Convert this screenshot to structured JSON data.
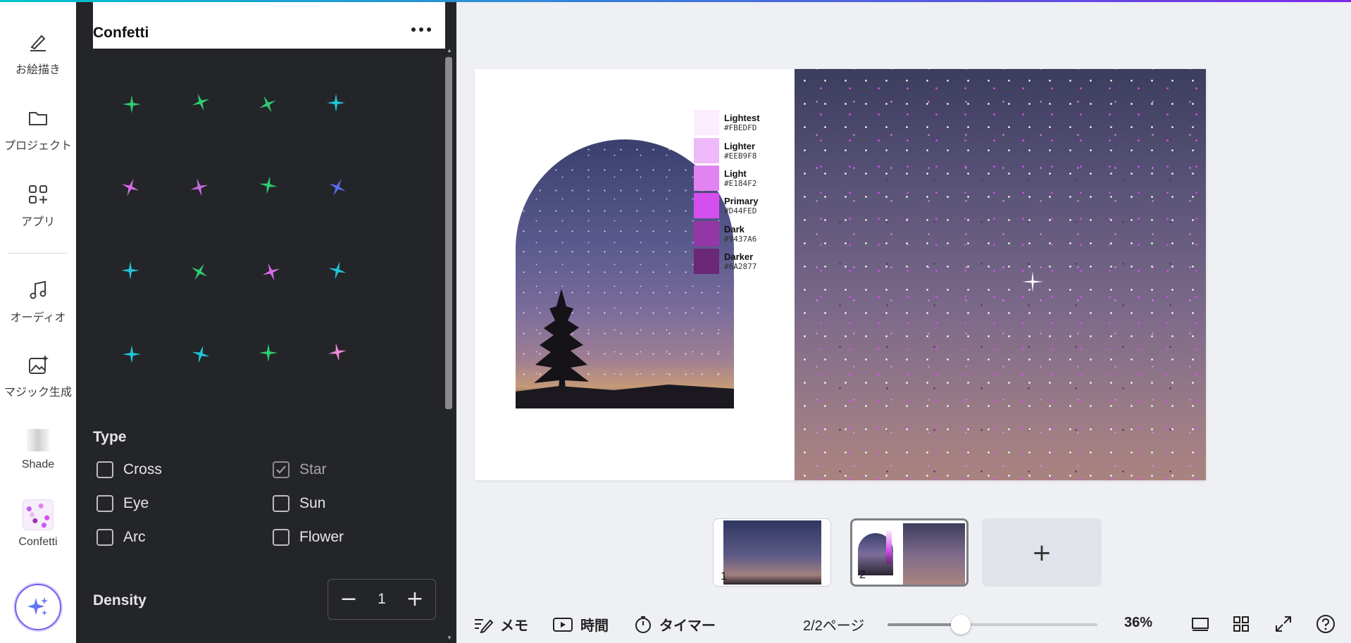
{
  "rail": {
    "items": [
      {
        "label": "お絵描き",
        "icon": "pen-draw-icon"
      },
      {
        "label": "プロジェクト",
        "icon": "folder-icon"
      },
      {
        "label": "アプリ",
        "icon": "apps-grid-icon"
      },
      {
        "label": "オーディオ",
        "icon": "music-note-icon"
      },
      {
        "label": "マジック生成",
        "icon": "magic-image-icon"
      },
      {
        "label": "Shade",
        "icon": "shade-app-icon"
      },
      {
        "label": "Confetti",
        "icon": "confetti-app-icon"
      }
    ],
    "magic_button_icon": "sparkle-icon"
  },
  "panel": {
    "title": "Confetti",
    "more_icon": "more-dots-icon",
    "sparkle_colors": [
      [
        "#2ecc71",
        "#2ecc71",
        "#2ecc71",
        "#20c5d8"
      ],
      [
        "#d86ae8",
        "#c46be0",
        "#2ecc71",
        "#5a6cf0"
      ],
      [
        "#20c5d8",
        "#2ecc71",
        "#d86ae8",
        "#20c5d8"
      ],
      [
        "#20c5d8",
        "#20c5d8",
        "#2ecc71",
        "#f08ad8"
      ]
    ],
    "type_label": "Type",
    "types": [
      {
        "label": "Cross",
        "checked": false
      },
      {
        "label": "Star",
        "checked": true
      },
      {
        "label": "Eye",
        "checked": false
      },
      {
        "label": "Sun",
        "checked": false
      },
      {
        "label": "Arc",
        "checked": false
      },
      {
        "label": "Flower",
        "checked": false
      }
    ],
    "density_label": "Density",
    "density_value": "1"
  },
  "canvas": {
    "palette": [
      {
        "name": "Lightest",
        "hex": "#FBEDFD"
      },
      {
        "name": "Lighter",
        "hex": "#EEB9F8"
      },
      {
        "name": "Light",
        "hex": "#E184F2"
      },
      {
        "name": "Primary",
        "hex": "#D44FED"
      },
      {
        "name": "Dark",
        "hex": "#9437A6"
      },
      {
        "name": "Darker",
        "hex": "#6A2877"
      }
    ]
  },
  "pages": {
    "thumbs": [
      {
        "number": "1",
        "selected": false
      },
      {
        "number": "2",
        "selected": true
      }
    ],
    "add_label": "+"
  },
  "bottom_bar": {
    "notes_label": "メモ",
    "time_label": "時間",
    "timer_label": "タイマー",
    "page_indicator": "2/2ページ",
    "zoom_level": 0.35,
    "zoom_label": "36%"
  },
  "accent": "#7d2ae8"
}
